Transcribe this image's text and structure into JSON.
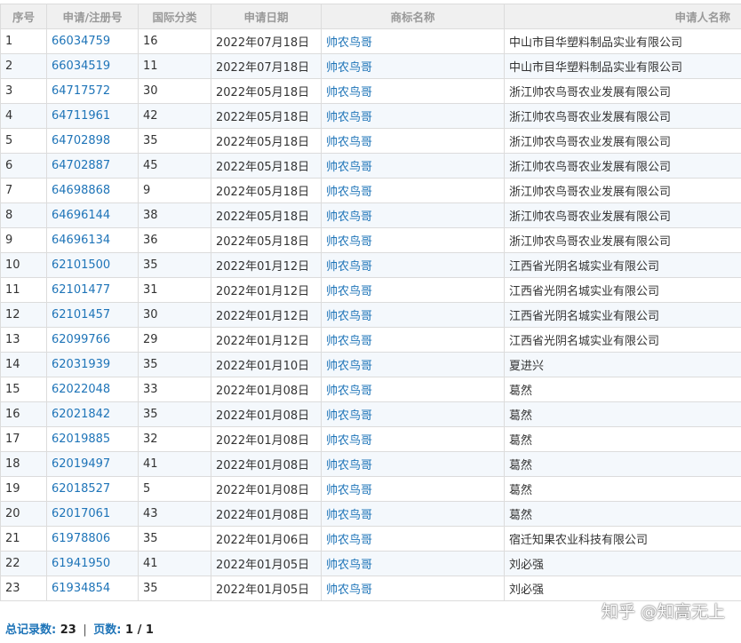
{
  "headers": [
    "序号",
    "申请/注册号",
    "国际分类",
    "申请日期",
    "商标名称",
    "申请人名称"
  ],
  "rows": [
    [
      "1",
      "66034759",
      "16",
      "2022年07月18日",
      "帅农鸟哥",
      "中山市目华塑料制品实业有限公司"
    ],
    [
      "2",
      "66034519",
      "11",
      "2022年07月18日",
      "帅农鸟哥",
      "中山市目华塑料制品实业有限公司"
    ],
    [
      "3",
      "64717572",
      "30",
      "2022年05月18日",
      "帅农鸟哥",
      "浙江帅农鸟哥农业发展有限公司"
    ],
    [
      "4",
      "64711961",
      "42",
      "2022年05月18日",
      "帅农鸟哥",
      "浙江帅农鸟哥农业发展有限公司"
    ],
    [
      "5",
      "64702898",
      "35",
      "2022年05月18日",
      "帅农鸟哥",
      "浙江帅农鸟哥农业发展有限公司"
    ],
    [
      "6",
      "64702887",
      "45",
      "2022年05月18日",
      "帅农鸟哥",
      "浙江帅农鸟哥农业发展有限公司"
    ],
    [
      "7",
      "64698868",
      "9",
      "2022年05月18日",
      "帅农鸟哥",
      "浙江帅农鸟哥农业发展有限公司"
    ],
    [
      "8",
      "64696144",
      "38",
      "2022年05月18日",
      "帅农鸟哥",
      "浙江帅农鸟哥农业发展有限公司"
    ],
    [
      "9",
      "64696134",
      "36",
      "2022年05月18日",
      "帅农鸟哥",
      "浙江帅农鸟哥农业发展有限公司"
    ],
    [
      "10",
      "62101500",
      "35",
      "2022年01月12日",
      "帅农鸟哥",
      "江西省光阴名城实业有限公司"
    ],
    [
      "11",
      "62101477",
      "31",
      "2022年01月12日",
      "帅农鸟哥",
      "江西省光阴名城实业有限公司"
    ],
    [
      "12",
      "62101457",
      "30",
      "2022年01月12日",
      "帅农鸟哥",
      "江西省光阴名城实业有限公司"
    ],
    [
      "13",
      "62099766",
      "29",
      "2022年01月12日",
      "帅农鸟哥",
      "江西省光阴名城实业有限公司"
    ],
    [
      "14",
      "62031939",
      "35",
      "2022年01月10日",
      "帅农鸟哥",
      "夏进兴"
    ],
    [
      "15",
      "62022048",
      "33",
      "2022年01月08日",
      "帅农鸟哥",
      "葛然"
    ],
    [
      "16",
      "62021842",
      "35",
      "2022年01月08日",
      "帅农鸟哥",
      "葛然"
    ],
    [
      "17",
      "62019885",
      "32",
      "2022年01月08日",
      "帅农鸟哥",
      "葛然"
    ],
    [
      "18",
      "62019497",
      "41",
      "2022年01月08日",
      "帅农鸟哥",
      "葛然"
    ],
    [
      "19",
      "62018527",
      "5",
      "2022年01月08日",
      "帅农鸟哥",
      "葛然"
    ],
    [
      "20",
      "62017061",
      "43",
      "2022年01月08日",
      "帅农鸟哥",
      "葛然"
    ],
    [
      "21",
      "61978806",
      "35",
      "2022年01月06日",
      "帅农鸟哥",
      "宿迁知果农业科技有限公司"
    ],
    [
      "22",
      "61941950",
      "41",
      "2022年01月05日",
      "帅农鸟哥",
      "刘必强"
    ],
    [
      "23",
      "61934854",
      "35",
      "2022年01月05日",
      "帅农鸟哥",
      "刘必强"
    ]
  ],
  "footer": {
    "total_label": "总记录数:",
    "total_value": "23",
    "separator": "|",
    "pages_label": "页数:",
    "pages_value": "1 / 1"
  },
  "watermark": "知乎 @知高无上",
  "colors": {
    "link": "#1e74b8",
    "header_bg": "#f0f0f0",
    "stripe": "#f4f8fc",
    "border": "#dcdcdc"
  }
}
